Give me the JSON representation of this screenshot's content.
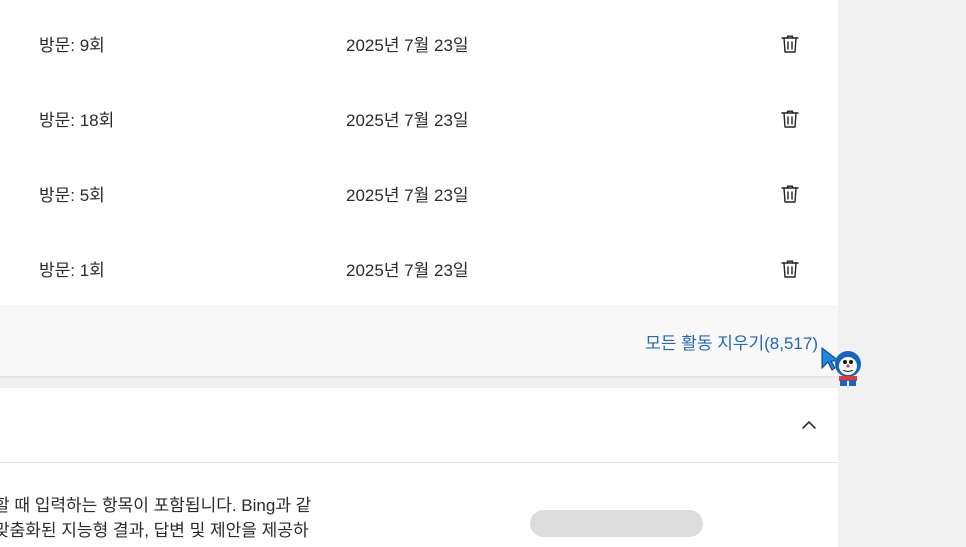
{
  "history": {
    "rows": [
      {
        "visits": "방문: 9회",
        "date": "2025년 7월 23일"
      },
      {
        "visits": "방문: 18회",
        "date": "2025년 7월 23일"
      },
      {
        "visits": "방문: 5회",
        "date": "2025년 7월 23일"
      },
      {
        "visits": "방문: 1회",
        "date": "2025년 7월 23일"
      }
    ],
    "clear_all_label": "모든 활동 지우기(8,517)"
  },
  "section": {
    "description_line1": "할 때 입력하는 항목이 포함됩니다. Bing과 같",
    "description_line2": "맞춤화된 지능형 결과, 답변 및 제안을 제공하"
  },
  "icons": {
    "row_action": "trash-icon",
    "section_toggle": "chevron-up-icon",
    "cursor": "mascot-cursor-icon"
  },
  "colors": {
    "link": "#2266b8",
    "footer_bg": "#f8f8f8",
    "page_bg": "#f1f1f1"
  }
}
